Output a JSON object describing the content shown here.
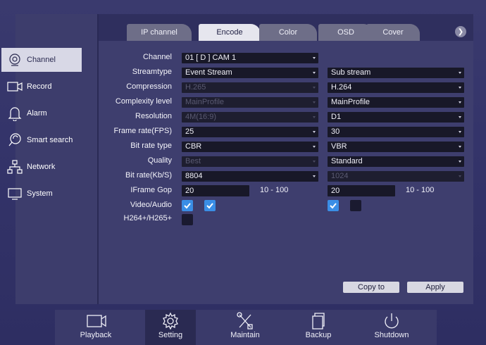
{
  "sidebar": {
    "items": [
      {
        "label": "Channel",
        "icon": "channel-icon",
        "active": true
      },
      {
        "label": "Record",
        "icon": "record-icon"
      },
      {
        "label": "Alarm",
        "icon": "bell-icon"
      },
      {
        "label": "Smart search",
        "icon": "smart-search-icon"
      },
      {
        "label": "Network",
        "icon": "network-icon"
      },
      {
        "label": "System",
        "icon": "monitor-icon"
      }
    ]
  },
  "tabs": [
    "IP channel",
    "Encode",
    "Color",
    "OSD",
    "Cover"
  ],
  "active_tab": "Encode",
  "form": {
    "labels": {
      "channel": "Channel",
      "streamtype": "Streamtype",
      "compression": "Compression",
      "complexity": "Complexity level",
      "resolution": "Resolution",
      "fps": "Frame rate(FPS)",
      "bitrate_type": "Bit rate type",
      "quality": "Quality",
      "bitrate": "Bit rate(Kb/S)",
      "iframe_gop": "IFrame Gop",
      "video_audio": "Video/Audio",
      "h264plus": "H264+/H265+"
    },
    "main": {
      "channel": "01 [ D ] CAM 1",
      "streamtype": "Event Stream",
      "compression": "H.265",
      "complexity": "MainProfile",
      "resolution": "4M(16:9)",
      "fps": "25",
      "bitrate_type": "CBR",
      "quality": "Best",
      "bitrate": "8804",
      "iframe_gop": "20",
      "gop_range": "10 - 100",
      "video_checked": true,
      "audio_checked": true,
      "h264plus_checked": false
    },
    "sub": {
      "streamtype": "Sub stream",
      "compression": "H.264",
      "complexity": "MainProfile",
      "resolution": "D1",
      "fps": "30",
      "bitrate_type": "VBR",
      "quality": "Standard",
      "bitrate": "1024",
      "iframe_gop": "20",
      "gop_range": "10 - 100",
      "video_checked": true,
      "audio_checked": false
    }
  },
  "buttons": {
    "copy_to": "Copy to",
    "apply": "Apply"
  },
  "bottom_nav": [
    {
      "label": "Playback",
      "icon": "camera-icon"
    },
    {
      "label": "Setting",
      "icon": "gear-icon",
      "active": true
    },
    {
      "label": "Maintain",
      "icon": "tools-icon"
    },
    {
      "label": "Backup",
      "icon": "backup-icon"
    },
    {
      "label": "Shutdown",
      "icon": "power-icon"
    }
  ],
  "colors": {
    "accent_checkbox": "#3a8ee6",
    "panel": "#3e3e6e",
    "field": "#181828"
  }
}
